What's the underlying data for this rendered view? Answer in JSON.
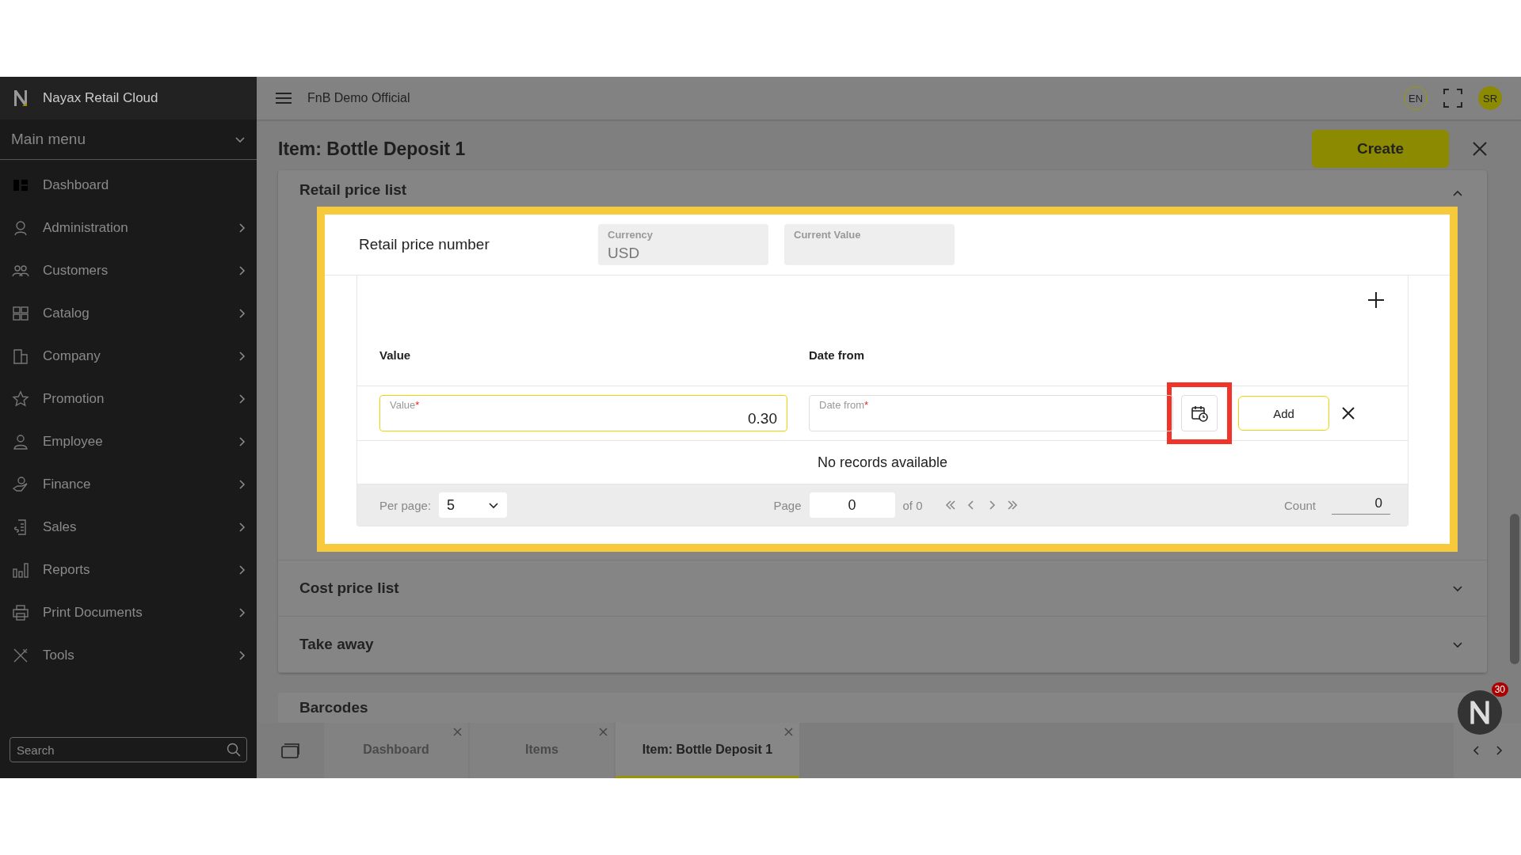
{
  "sidebar": {
    "brand": "Nayax Retail Cloud",
    "menu_title": "Main menu",
    "items": [
      {
        "label": "Dashboard",
        "has_submenu": false
      },
      {
        "label": "Administration",
        "has_submenu": true
      },
      {
        "label": "Customers",
        "has_submenu": true
      },
      {
        "label": "Catalog",
        "has_submenu": true
      },
      {
        "label": "Company",
        "has_submenu": true
      },
      {
        "label": "Promotion",
        "has_submenu": true
      },
      {
        "label": "Employee",
        "has_submenu": true
      },
      {
        "label": "Finance",
        "has_submenu": true
      },
      {
        "label": "Sales",
        "has_submenu": true
      },
      {
        "label": "Reports",
        "has_submenu": true
      },
      {
        "label": "Print Documents",
        "has_submenu": true
      },
      {
        "label": "Tools",
        "has_submenu": true
      }
    ],
    "search": {
      "placeholder": "Search"
    }
  },
  "header": {
    "company": "FnB Demo Official",
    "language": "EN",
    "user_initials": "SR"
  },
  "page": {
    "title": "Item: Bottle Deposit 1",
    "create_button": "Create"
  },
  "sections": [
    {
      "title": "Retail price list",
      "expanded": true,
      "highlighted": true,
      "price_row": {
        "label": "Retail price number",
        "fields": [
          {
            "label": "Currency",
            "value": "USD"
          },
          {
            "label": "Current Value"
          }
        ]
      },
      "table": {
        "columns": [
          "Value",
          "Date from"
        ],
        "new_row": {
          "value_field": {
            "label": "Value",
            "required_mark": "*",
            "value": "0.30"
          },
          "date_field": {
            "label": "Date from",
            "required_mark": "*"
          },
          "calendar_highlighted": true,
          "add_button": "Add"
        },
        "empty_text": "No records available",
        "footer": {
          "per_page_label": "Per page:",
          "per_page": "5",
          "page_label": "Page",
          "page": "0",
          "of": "of 0",
          "count_label": "Count",
          "count": "0"
        }
      }
    },
    {
      "title": "Cost price list",
      "expanded": false
    },
    {
      "title": "Take away",
      "expanded": false
    }
  ],
  "barcodes_title": "Barcodes",
  "bottom_tabs": [
    {
      "label": "Dashboard",
      "selected": false
    },
    {
      "label": "Items",
      "selected": false
    },
    {
      "label": "Item: Bottle Deposit 1",
      "selected": true
    }
  ],
  "assistant_badge": "30"
}
